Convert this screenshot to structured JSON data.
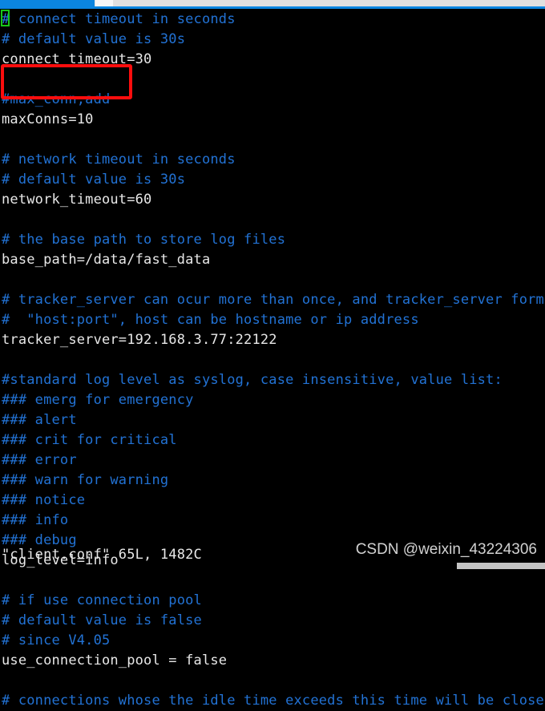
{
  "window": {
    "type": "terminal-vim-editor",
    "background_color": "#000000",
    "comment_color": "#2272d4",
    "value_color": "#e8e8e8",
    "cursor_color": "#18c718",
    "highlight_color": "#fc0d0d"
  },
  "topbar": {
    "progress_color": "#0b85e0",
    "track_color": "#e0e0e0",
    "gap_color": "#f7f7f7"
  },
  "editor": {
    "lines": [
      {
        "text": "# connect timeout in seconds",
        "kind": "comment"
      },
      {
        "text": "# default value is 30s",
        "kind": "comment"
      },
      {
        "text": "connect_timeout=30",
        "kind": "value"
      },
      {
        "text": "",
        "kind": "blank"
      },
      {
        "text": "#max_conn,add",
        "kind": "comment"
      },
      {
        "text": "maxConns=10",
        "kind": "value"
      },
      {
        "text": "",
        "kind": "blank"
      },
      {
        "text": "# network timeout in seconds",
        "kind": "comment"
      },
      {
        "text": "# default value is 30s",
        "kind": "comment"
      },
      {
        "text": "network_timeout=60",
        "kind": "value"
      },
      {
        "text": "",
        "kind": "blank"
      },
      {
        "text": "# the base path to store log files",
        "kind": "comment"
      },
      {
        "text": "base_path=/data/fast_data",
        "kind": "value"
      },
      {
        "text": "",
        "kind": "blank"
      },
      {
        "text": "# tracker_server can ocur more than once, and tracker_server format is",
        "kind": "comment"
      },
      {
        "text": "#  \"host:port\", host can be hostname or ip address",
        "kind": "comment"
      },
      {
        "text": "tracker_server=192.168.3.77:22122",
        "kind": "value"
      },
      {
        "text": "",
        "kind": "blank"
      },
      {
        "text": "#standard log level as syslog, case insensitive, value list:",
        "kind": "comment"
      },
      {
        "text": "### emerg for emergency",
        "kind": "comment"
      },
      {
        "text": "### alert",
        "kind": "comment"
      },
      {
        "text": "### crit for critical",
        "kind": "comment"
      },
      {
        "text": "### error",
        "kind": "comment"
      },
      {
        "text": "### warn for warning",
        "kind": "comment"
      },
      {
        "text": "### notice",
        "kind": "comment"
      },
      {
        "text": "### info",
        "kind": "comment"
      },
      {
        "text": "### debug",
        "kind": "comment"
      },
      {
        "text": "log_level=info",
        "kind": "value"
      },
      {
        "text": "",
        "kind": "blank"
      },
      {
        "text": "# if use connection pool",
        "kind": "comment"
      },
      {
        "text": "# default value is false",
        "kind": "comment"
      },
      {
        "text": "# since V4.05",
        "kind": "comment"
      },
      {
        "text": "use_connection_pool = false",
        "kind": "value"
      },
      {
        "text": "",
        "kind": "blank"
      },
      {
        "text": "# connections whose the idle time exceeds this time will be closed",
        "kind": "comment"
      }
    ]
  },
  "status_line": {
    "text": "\"client.conf\" 65L, 1482C",
    "filename": "client.conf",
    "line_count": "65L",
    "byte_count": "1482C"
  },
  "annotation": {
    "highlight_label": "max-conns-highlight"
  },
  "watermark": {
    "text": "CSDN @weixin_43224306"
  }
}
